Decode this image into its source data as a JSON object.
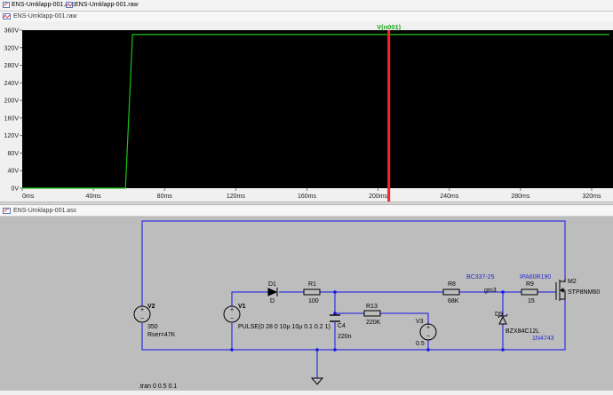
{
  "tabs": [
    {
      "label": "ENS-Umklapp-001.asc",
      "icon": "schematic-icon"
    },
    {
      "label": "ENS-Umklapp-001.raw",
      "icon": "waveform-icon"
    }
  ],
  "plot_window": {
    "title": "ENS-Umklapp-001.raw",
    "trace_label": "V(n001)",
    "cursor_color": "#ff2020",
    "trace_color": "#17c617"
  },
  "schematic_window": {
    "title": "ENS-Umklapp-001.asc",
    "wire_color": "#1414e6",
    "labels": {
      "v2_name": "V2",
      "v2_value": "350",
      "v2_rser": "Rser=47K",
      "v1_name": "V1",
      "v1_value": "PULSE(0 28 0 10µ 10µ 0.1 0.2 1)",
      "d1_name": "D1",
      "d1_model": "D",
      "r1_name": "R1",
      "r1_value": "100",
      "c4_name": "C4",
      "c4_value": "220n",
      "r13_name": "R13",
      "r13_value": "220K",
      "v3_name": "V3",
      "v3_value": "0.5",
      "r8_name": "R8",
      "r8_value": "68K",
      "net_gm3": "gm3",
      "bc_note": "BC337-25",
      "ipa_note": "IPA60R190",
      "r9_name": "R9",
      "r9_value": "15",
      "m2_name": "M2",
      "m2_model": "STP8NM60",
      "d9_name": "D9",
      "d9_model": "BZX84C12L",
      "note_1n": "1N4743",
      "tran": ".tran 0 0.5 0.1"
    }
  },
  "chart_data": {
    "type": "line",
    "title": "",
    "series": [
      {
        "name": "V(n001)",
        "color": "#17c617",
        "x": [
          0,
          58,
          62,
          330
        ],
        "y": [
          0,
          0,
          350,
          350
        ]
      }
    ],
    "xlabel": "",
    "ylabel": "",
    "xlim": [
      0,
      332
    ],
    "ylim": [
      0,
      360
    ],
    "x_ticks": [
      0,
      40,
      80,
      120,
      160,
      200,
      240,
      280,
      320
    ],
    "x_tick_labels": [
      "0ms",
      "40ms",
      "80ms",
      "120ms",
      "160ms",
      "200ms",
      "240ms",
      "280ms",
      "320ms"
    ],
    "y_ticks": [
      0,
      40,
      80,
      120,
      160,
      200,
      240,
      280,
      320,
      360
    ],
    "y_tick_labels": [
      "0V",
      "40V",
      "80V",
      "120V",
      "160V",
      "200V",
      "240V",
      "280V",
      "320V",
      "360V"
    ],
    "cursor_x": 206,
    "grid": false,
    "background": "#000000"
  }
}
